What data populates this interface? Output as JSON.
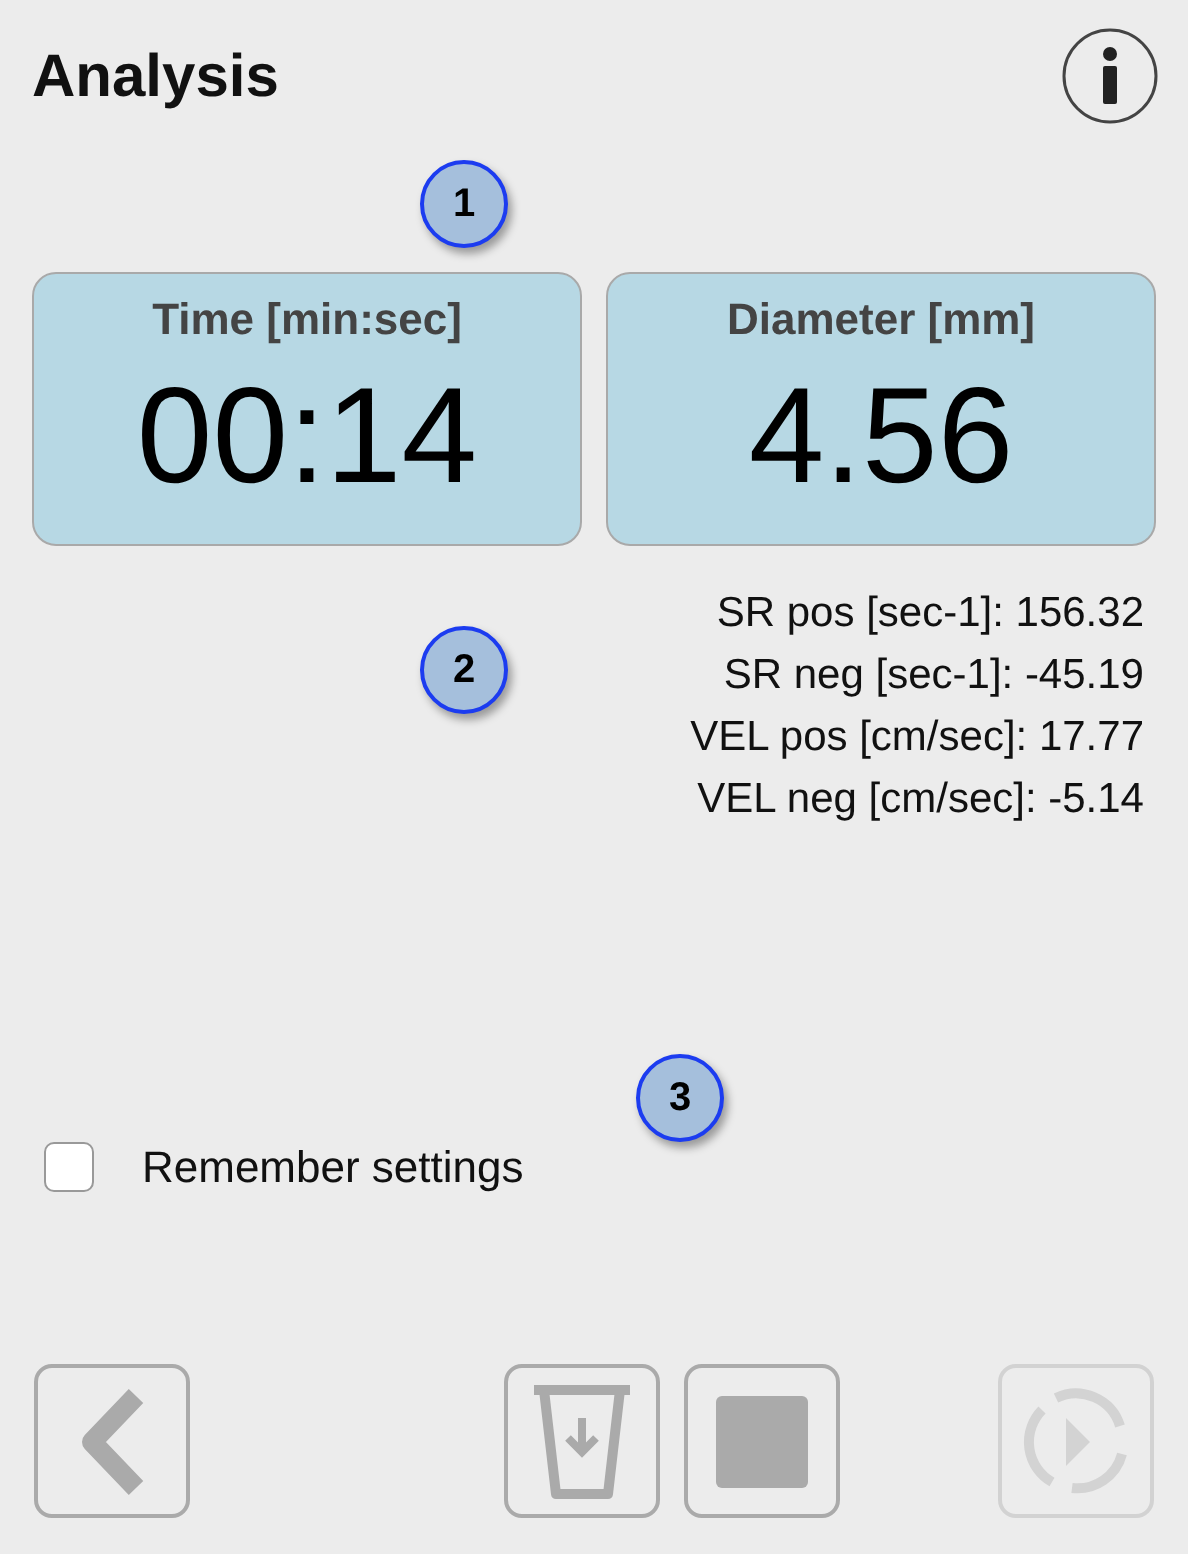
{
  "header": {
    "title": "Analysis"
  },
  "callouts": [
    {
      "label": "1"
    },
    {
      "label": "2"
    },
    {
      "label": "3"
    }
  ],
  "readouts": [
    {
      "label": "Time [min:sec]",
      "value": "00:14"
    },
    {
      "label": "Diameter [mm]",
      "value": "4.56"
    }
  ],
  "metrics": [
    "SR pos [sec-1]: 156.32",
    "SR neg [sec-1]: -45.19",
    "VEL pos [cm/sec]: 17.77",
    "VEL neg [cm/sec]: -5.14"
  ],
  "remember_settings": {
    "label": "Remember settings",
    "checked": false
  },
  "toolbar": [
    {
      "kind": "back",
      "disabled": false
    },
    {
      "kind": "discard",
      "disabled": false
    },
    {
      "kind": "stop",
      "disabled": false
    },
    {
      "kind": "replay",
      "disabled": true
    }
  ]
}
